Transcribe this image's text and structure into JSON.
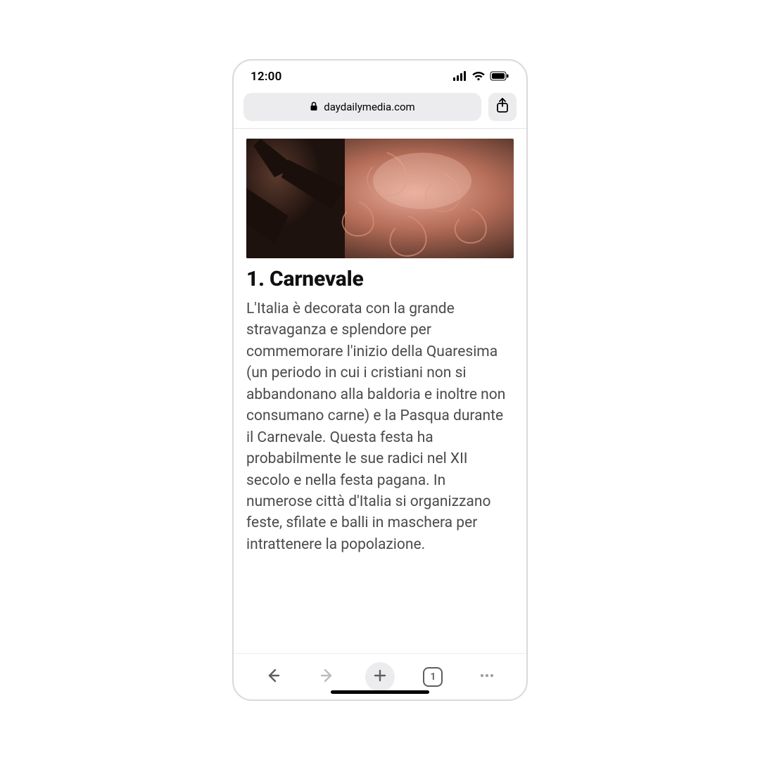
{
  "status": {
    "time": "12:00"
  },
  "browser": {
    "domain": "daydailymedia.com",
    "tab_count": "1"
  },
  "article": {
    "heading": "1. Carnevale",
    "body": "L'Italia è decorata con la grande stravaganza e splendore per commemorare l'inizio della Quaresima (un periodo in cui i cristiani non si abbandonano alla baldoria e inoltre non consumano carne) e la Pasqua durante il Carnevale. Questa festa ha probabilmente le sue radici nel XII secolo e nella festa pagana. In numerose città d'Italia si organizzano feste, sfilate e balli in maschera per intrattenere la popolazione."
  }
}
